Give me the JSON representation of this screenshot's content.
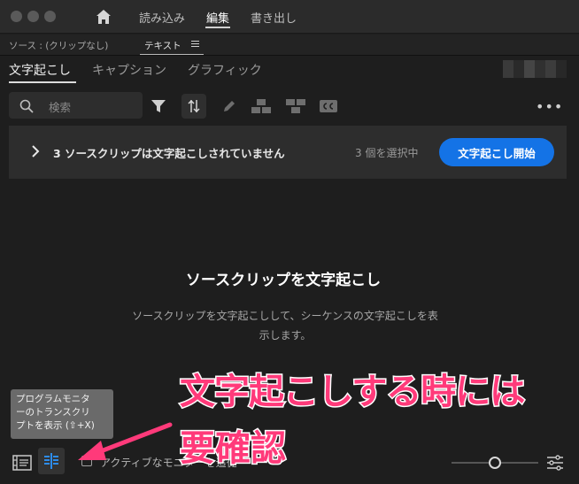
{
  "window": {
    "menu": [
      {
        "label": "読み込み",
        "active": false
      },
      {
        "label": "編集",
        "active": true
      },
      {
        "label": "書き出し",
        "active": false
      }
    ]
  },
  "panel": {
    "source_label": "ソース : (クリップなし)",
    "tab_label": "テキスト"
  },
  "tabs": [
    {
      "label": "文字起こし",
      "active": true
    },
    {
      "label": "キャプション",
      "active": false
    },
    {
      "label": "グラフィック",
      "active": false
    }
  ],
  "toolbar": {
    "search_placeholder": "検索",
    "more_label": "•••"
  },
  "banner": {
    "message": "3 ソースクリップは文字起こしされていません",
    "selection_count": "3 個を選択中",
    "start_button": "文字起こし開始"
  },
  "empty_state": {
    "title": "ソースクリップを文字起こし",
    "description": "ソースクリップを文字起こしして、シーケンスの文字起こしを表示します。"
  },
  "tooltip": {
    "lines": [
      "プログラムモニタ",
      "ーのトランスクリ",
      "プトを表示 (⇧+X)"
    ]
  },
  "annotation": {
    "line1": "文字起こしする時には",
    "line2": "要確認"
  },
  "footer": {
    "checkbox_label": "アクティブなモニターを追従"
  },
  "colors": {
    "accent": "#1473e6",
    "annotation": "#ff3a7a"
  }
}
